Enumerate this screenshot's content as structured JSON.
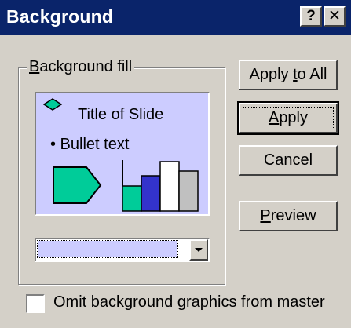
{
  "window": {
    "title": "Background",
    "help_label": "?",
    "close_label": "✕"
  },
  "group": {
    "label_pre": "",
    "label_key": "B",
    "label_post": "ackground fill"
  },
  "preview": {
    "title": "Title of Slide",
    "bullet": "• Bullet text"
  },
  "combo": {
    "selected_color": "#ccccff"
  },
  "buttons": {
    "apply_all": {
      "pre": "Apply ",
      "key": "t",
      "post": "o All"
    },
    "apply": {
      "pre": "",
      "key": "A",
      "post": "pply"
    },
    "cancel": {
      "label": "Cancel"
    },
    "preview": {
      "pre": "",
      "key": "P",
      "post": "review"
    }
  },
  "checkbox": {
    "label_pre": "Omit background ",
    "label_key": "g",
    "label_post": "raphics from master",
    "checked": false
  },
  "colors": {
    "titlebar": "#0a246a",
    "face": "#d4d0c8",
    "preview_bg": "#ccccff",
    "shape_green": "#00cc99",
    "bar_blue": "#3333cc",
    "bar_gray": "#c0c0c0"
  }
}
